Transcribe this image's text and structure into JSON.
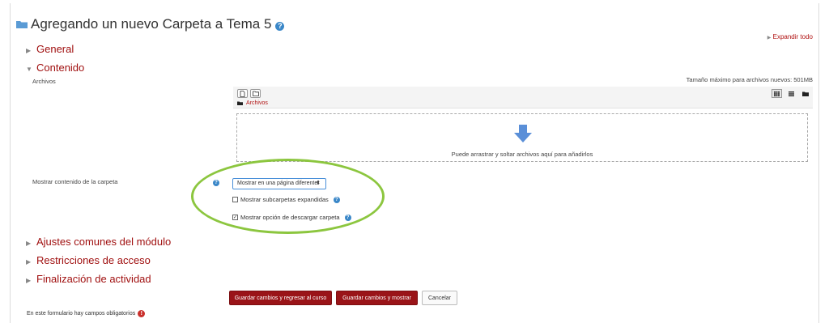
{
  "page": {
    "title": "Agregando un nuevo Carpeta a Tema 5",
    "help_glyph": "?",
    "expand_all": "Expandir todo"
  },
  "sections": {
    "general": "General",
    "contenido": "Contenido",
    "ajustes": "Ajustes comunes del módulo",
    "restricciones": "Restricciones de acceso",
    "finalizacion": "Finalización de actividad"
  },
  "files": {
    "label": "Archivos",
    "max_size": "Tamaño máximo para archivos nuevos: 501MB",
    "path_root": "Archivos",
    "drop_text": "Puede arrastrar y soltar archivos aquí para añadirlos"
  },
  "display": {
    "label": "Mostrar contenido de la carpeta",
    "select_value": "Mostrar en una página diferente",
    "show_subfolders_label": "Mostrar subcarpetas expandidas",
    "show_subfolders_checked": false,
    "download_label": "Mostrar opción de descargar carpeta",
    "download_checked": true
  },
  "buttons": {
    "save_return": "Guardar cambios y regresar al curso",
    "save_show": "Guardar cambios y mostrar",
    "cancel": "Cancelar"
  },
  "footer": {
    "required_note": "En este formulario hay campos obligatorios",
    "required_glyph": "!"
  },
  "colors": {
    "accent_red": "#9a1418",
    "link_red": "#a01010",
    "help_blue": "#3a87c8",
    "highlight_green": "#8cc63f"
  }
}
